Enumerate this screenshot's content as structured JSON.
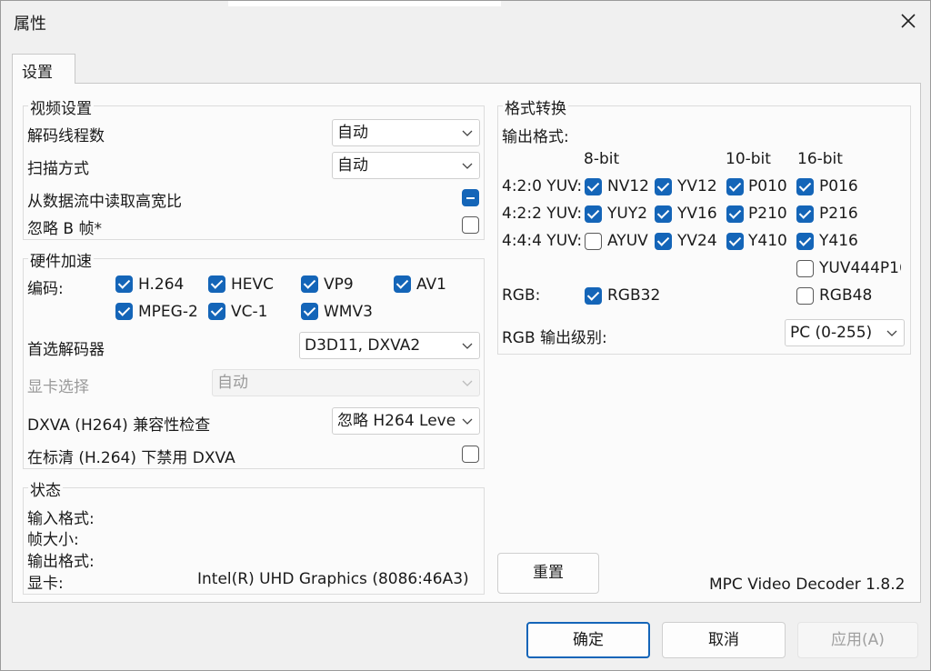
{
  "window": {
    "title": "属性"
  },
  "tabs": [
    {
      "label": "设置"
    }
  ],
  "video_settings": {
    "title": "视频设置",
    "decode_threads": {
      "label": "解码线程数",
      "value": "自动"
    },
    "scan_mode": {
      "label": "扫描方式",
      "value": "自动"
    },
    "read_aspect": {
      "label": "从数据流中读取高宽比",
      "state": "indeterminate"
    },
    "skip_b": {
      "label": "忽略 B 帧*",
      "checked": false
    }
  },
  "hw_accel": {
    "title": "硬件加速",
    "codec_label": "编码:",
    "codecs": [
      {
        "label": "H.264",
        "checked": true
      },
      {
        "label": "HEVC",
        "checked": true
      },
      {
        "label": "VP9",
        "checked": true
      },
      {
        "label": "AV1",
        "checked": true
      },
      {
        "label": "MPEG-2",
        "checked": true
      },
      {
        "label": "VC-1",
        "checked": true
      },
      {
        "label": "WMV3",
        "checked": true
      }
    ],
    "preferred_decoder": {
      "label": "首选解码器",
      "value": "D3D11, DXVA2"
    },
    "gpu_select": {
      "label": "显卡选择",
      "value": "自动"
    },
    "dxva_check": {
      "label": "DXVA (H264) 兼容性检查",
      "value": "忽略 H264 Level"
    },
    "sd_disable": {
      "label": "在标清 (H.264) 下禁用 DXVA",
      "checked": false
    }
  },
  "status": {
    "title": "状态",
    "input_format": "输入格式:",
    "frame_size": "帧大小:",
    "output_format": "输出格式:",
    "gpu_label": "显卡:",
    "gpu_value": "Intel(R) UHD Graphics (8086:46A3)"
  },
  "format_conv": {
    "title": "格式转换",
    "output_label": "输出格式:",
    "col_8bit": "8-bit",
    "col_10bit": "10-bit",
    "col_16bit": "16-bit",
    "rows": [
      {
        "label": "4:2:0 YUV:",
        "items": [
          {
            "label": "NV12",
            "checked": true
          },
          {
            "label": "YV12",
            "checked": true
          },
          {
            "label": "P010",
            "checked": true
          },
          {
            "label": "P016",
            "checked": true
          }
        ]
      },
      {
        "label": "4:2:2 YUV:",
        "items": [
          {
            "label": "YUY2",
            "checked": true
          },
          {
            "label": "YV16",
            "checked": true
          },
          {
            "label": "P210",
            "checked": true
          },
          {
            "label": "P216",
            "checked": true
          }
        ]
      },
      {
        "label": "4:4:4 YUV:",
        "items": [
          {
            "label": "AYUV",
            "checked": false
          },
          {
            "label": "YV24",
            "checked": true
          },
          {
            "label": "Y410",
            "checked": true
          },
          {
            "label": "Y416",
            "checked": true
          }
        ]
      }
    ],
    "yuv444p16": {
      "label": "YUV444P16",
      "checked": false
    },
    "rgb_label": "RGB:",
    "rgb32": {
      "label": "RGB32",
      "checked": true
    },
    "rgb48": {
      "label": "RGB48",
      "checked": false
    },
    "rgb_level": {
      "label": "RGB 输出级别:",
      "value": "PC (0-255)"
    }
  },
  "reset_button": "重置",
  "version": "MPC Video Decoder 1.8.2",
  "buttons": {
    "ok": "确定",
    "cancel": "取消",
    "apply": "应用(A)"
  },
  "colors": {
    "accent": "#1465b8"
  }
}
